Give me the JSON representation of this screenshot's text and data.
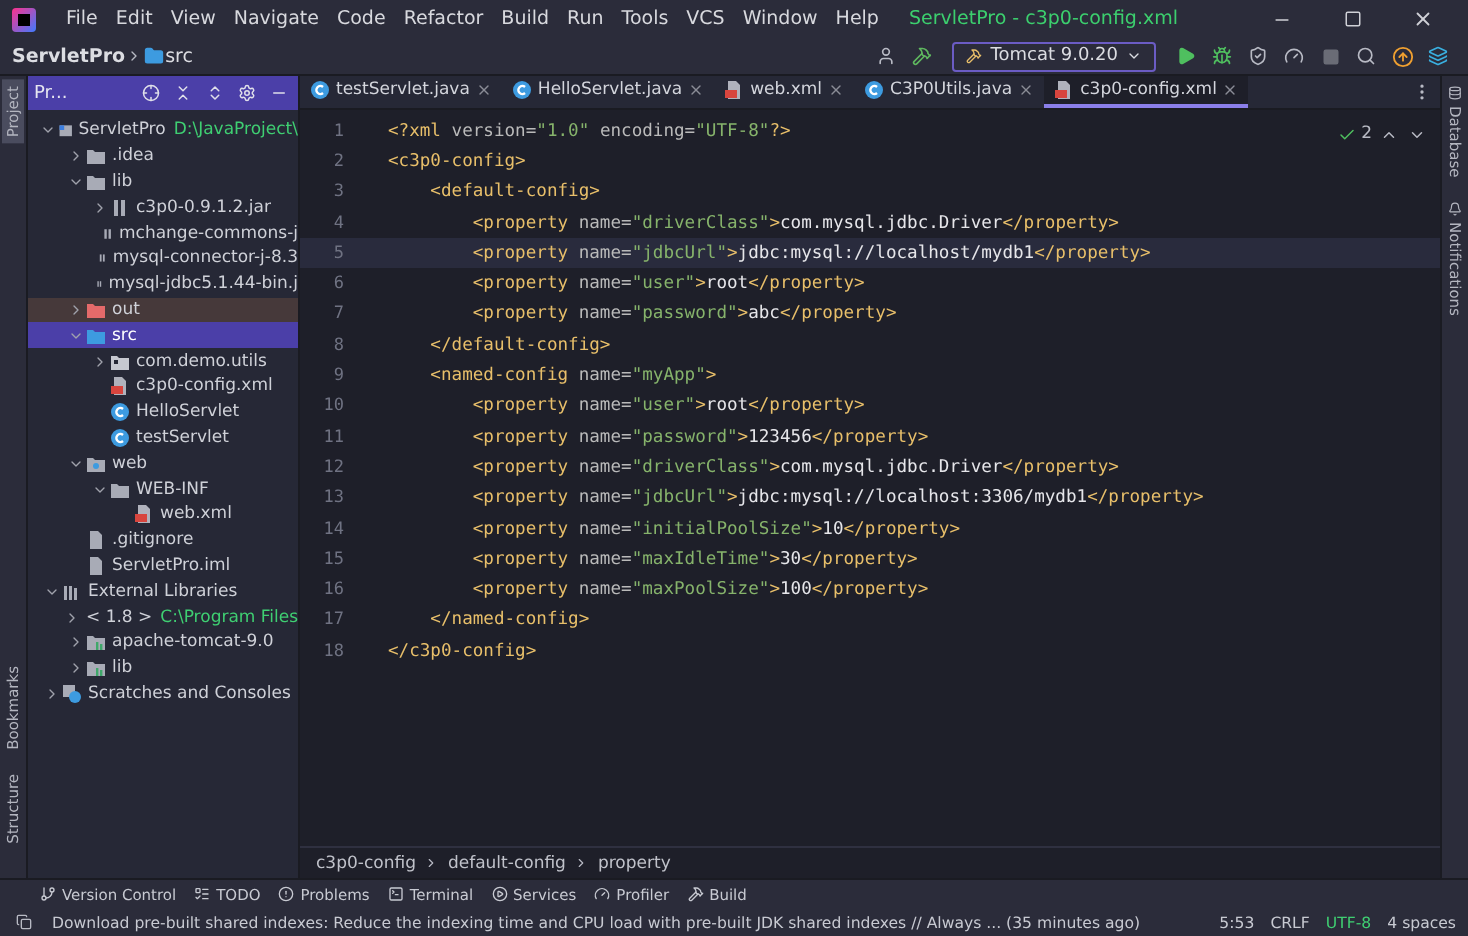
{
  "window": {
    "title": "ServletPro - c3p0-config.xml"
  },
  "menu": [
    "File",
    "Edit",
    "View",
    "Navigate",
    "Code",
    "Refactor",
    "Build",
    "Run",
    "Tools",
    "VCS",
    "Window",
    "Help"
  ],
  "navbar": {
    "breadcrumb": [
      "ServletPro",
      "src"
    ],
    "run_config": "Tomcat 9.0.20"
  },
  "left_strip": [
    {
      "label": "Project",
      "selected": true
    },
    {
      "label": "Bookmarks",
      "selected": false
    },
    {
      "label": "Structure",
      "selected": false
    }
  ],
  "right_strip": [
    "Database",
    "Notifications"
  ],
  "project_panel": {
    "title": "Pr...",
    "tree": [
      {
        "label": "ServletPro",
        "kind": "project",
        "note": "D:\\JavaProject\\",
        "expanded": true,
        "selected": false,
        "children": [
          {
            "label": ".idea",
            "kind": "folder",
            "expanded": false,
            "selected": false
          },
          {
            "label": "lib",
            "kind": "folder",
            "expanded": true,
            "selected": false,
            "children": [
              {
                "label": "c3p0-0.9.1.2.jar",
                "kind": "jar",
                "expanded": false,
                "selected": false
              },
              {
                "label": "mchange-commons-j",
                "kind": "jar",
                "selected": false
              },
              {
                "label": "mysql-connector-j-8.3",
                "kind": "jar",
                "selected": false
              },
              {
                "label": "mysql-jdbc5.1.44-bin.j",
                "kind": "jar",
                "selected": false
              }
            ]
          },
          {
            "label": "out",
            "kind": "excluded-folder",
            "expanded": false,
            "selected": false
          },
          {
            "label": "src",
            "kind": "source-folder",
            "expanded": true,
            "selected": true,
            "children": [
              {
                "label": "com.demo.utils",
                "kind": "package",
                "expanded": false,
                "selected": false
              },
              {
                "label": "c3p0-config.xml",
                "kind": "xml",
                "selected": false
              },
              {
                "label": "HelloServlet",
                "kind": "class",
                "selected": false
              },
              {
                "label": "testServlet",
                "kind": "class",
                "selected": false
              }
            ]
          },
          {
            "label": "web",
            "kind": "web-folder",
            "expanded": true,
            "selected": false,
            "children": [
              {
                "label": "WEB-INF",
                "kind": "folder",
                "expanded": true,
                "selected": false,
                "children": [
                  {
                    "label": "web.xml",
                    "kind": "xml",
                    "selected": false
                  }
                ]
              }
            ]
          },
          {
            "label": ".gitignore",
            "kind": "file",
            "selected": false
          },
          {
            "label": "ServletPro.iml",
            "kind": "file",
            "selected": false
          }
        ]
      },
      {
        "label": "External Libraries",
        "kind": "libraries",
        "expanded": true,
        "selected": false,
        "children": [
          {
            "label": "< 1.8 >",
            "kind": "sdk",
            "note": "C:\\Program Files",
            "expanded": false,
            "selected": false
          },
          {
            "label": "apache-tomcat-9.0",
            "kind": "library",
            "expanded": false,
            "selected": false
          },
          {
            "label": "lib",
            "kind": "library",
            "expanded": false,
            "selected": false
          }
        ]
      },
      {
        "label": "Scratches and Consoles",
        "kind": "scratch",
        "expanded": false,
        "selected": false
      }
    ]
  },
  "editor": {
    "tabs": [
      {
        "label": "testServlet.java",
        "kind": "class",
        "selected": false
      },
      {
        "label": "HelloServlet.java",
        "kind": "class",
        "selected": false
      },
      {
        "label": "web.xml",
        "kind": "xml",
        "selected": false
      },
      {
        "label": "C3P0Utils.java",
        "kind": "class",
        "selected": false
      },
      {
        "label": "c3p0-config.xml",
        "kind": "xml",
        "selected": true
      }
    ],
    "inspection_count": "2",
    "lines": [
      {
        "number": "1",
        "current": false,
        "tokens": [
          {
            "kind": "tag",
            "text": "<?xml "
          },
          {
            "kind": "attr",
            "text": "version="
          },
          {
            "kind": "value",
            "text": "\"1.0\" "
          },
          {
            "kind": "attr",
            "text": "encoding="
          },
          {
            "kind": "value",
            "text": "\"UTF-8\""
          },
          {
            "kind": "tag",
            "text": "?>"
          }
        ]
      },
      {
        "number": "2",
        "current": false,
        "tokens": [
          {
            "kind": "tag",
            "text": "<c3p0-config>"
          }
        ]
      },
      {
        "number": "3",
        "current": false,
        "tokens": [
          {
            "kind": "tag",
            "text": "    <default-config>"
          }
        ]
      },
      {
        "number": "4",
        "current": false,
        "tokens": [
          {
            "kind": "tag",
            "text": "        <property "
          },
          {
            "kind": "attr",
            "text": "name="
          },
          {
            "kind": "value",
            "text": "\"driverClass\""
          },
          {
            "kind": "tag",
            "text": ">"
          },
          {
            "kind": "text",
            "text": "com.mysql.jdbc.Driver"
          },
          {
            "kind": "tag",
            "text": "</property>"
          }
        ]
      },
      {
        "number": "5",
        "current": true,
        "tokens": [
          {
            "kind": "tag",
            "text": "        <property "
          },
          {
            "kind": "attr",
            "text": "name="
          },
          {
            "kind": "value",
            "text": "\"jdbcUrl\""
          },
          {
            "kind": "tag",
            "text": ">"
          },
          {
            "kind": "text",
            "text": "jdbc:mysql://localhost/mydb1"
          },
          {
            "kind": "tag",
            "text": "</property>"
          }
        ]
      },
      {
        "number": "6",
        "current": false,
        "tokens": [
          {
            "kind": "tag",
            "text": "        <property "
          },
          {
            "kind": "attr",
            "text": "name="
          },
          {
            "kind": "value",
            "text": "\"user\""
          },
          {
            "kind": "tag",
            "text": ">"
          },
          {
            "kind": "text",
            "text": "root"
          },
          {
            "kind": "tag",
            "text": "</property>"
          }
        ]
      },
      {
        "number": "7",
        "current": false,
        "tokens": [
          {
            "kind": "tag",
            "text": "        <property "
          },
          {
            "kind": "attr",
            "text": "name="
          },
          {
            "kind": "value",
            "text": "\"password\""
          },
          {
            "kind": "tag",
            "text": ">"
          },
          {
            "kind": "text",
            "text": "abc"
          },
          {
            "kind": "tag",
            "text": "</property>"
          }
        ]
      },
      {
        "number": "8",
        "current": false,
        "tokens": [
          {
            "kind": "tag",
            "text": "    </default-config>"
          }
        ]
      },
      {
        "number": "9",
        "current": false,
        "tokens": [
          {
            "kind": "tag",
            "text": "    <named-config "
          },
          {
            "kind": "attr",
            "text": "name="
          },
          {
            "kind": "value",
            "text": "\"myApp\""
          },
          {
            "kind": "tag",
            "text": ">"
          }
        ]
      },
      {
        "number": "10",
        "current": false,
        "tokens": [
          {
            "kind": "tag",
            "text": "        <property "
          },
          {
            "kind": "attr",
            "text": "name="
          },
          {
            "kind": "value",
            "text": "\"user\""
          },
          {
            "kind": "tag",
            "text": ">"
          },
          {
            "kind": "text",
            "text": "root"
          },
          {
            "kind": "tag",
            "text": "</property>"
          }
        ]
      },
      {
        "number": "11",
        "current": false,
        "tokens": [
          {
            "kind": "tag",
            "text": "        <property "
          },
          {
            "kind": "attr",
            "text": "name="
          },
          {
            "kind": "value",
            "text": "\"password\""
          },
          {
            "kind": "tag",
            "text": ">"
          },
          {
            "kind": "text",
            "text": "123456"
          },
          {
            "kind": "tag",
            "text": "</property>"
          }
        ]
      },
      {
        "number": "12",
        "current": false,
        "tokens": [
          {
            "kind": "tag",
            "text": "        <property "
          },
          {
            "kind": "attr",
            "text": "name="
          },
          {
            "kind": "value",
            "text": "\"driverClass\""
          },
          {
            "kind": "tag",
            "text": ">"
          },
          {
            "kind": "text",
            "text": "com.mysql.jdbc.Driver"
          },
          {
            "kind": "tag",
            "text": "</property>"
          }
        ]
      },
      {
        "number": "13",
        "current": false,
        "tokens": [
          {
            "kind": "tag",
            "text": "        <property "
          },
          {
            "kind": "attr",
            "text": "name="
          },
          {
            "kind": "value",
            "text": "\"jdbcUrl\""
          },
          {
            "kind": "tag",
            "text": ">"
          },
          {
            "kind": "text",
            "text": "jdbc:mysql://localhost:3306/mydb1"
          },
          {
            "kind": "tag",
            "text": "</property>"
          }
        ]
      },
      {
        "number": "14",
        "current": false,
        "tokens": [
          {
            "kind": "tag",
            "text": "        <property "
          },
          {
            "kind": "attr",
            "text": "name="
          },
          {
            "kind": "value",
            "text": "\"initialPoolSize\""
          },
          {
            "kind": "tag",
            "text": ">"
          },
          {
            "kind": "text",
            "text": "10"
          },
          {
            "kind": "tag",
            "text": "</property>"
          }
        ]
      },
      {
        "number": "15",
        "current": false,
        "tokens": [
          {
            "kind": "tag",
            "text": "        <property "
          },
          {
            "kind": "attr",
            "text": "name="
          },
          {
            "kind": "value",
            "text": "\"maxIdleTime\""
          },
          {
            "kind": "tag",
            "text": ">"
          },
          {
            "kind": "text",
            "text": "30"
          },
          {
            "kind": "tag",
            "text": "</property>"
          }
        ]
      },
      {
        "number": "16",
        "current": false,
        "tokens": [
          {
            "kind": "tag",
            "text": "        <property "
          },
          {
            "kind": "attr",
            "text": "name="
          },
          {
            "kind": "value",
            "text": "\"maxPoolSize\""
          },
          {
            "kind": "tag",
            "text": ">"
          },
          {
            "kind": "text",
            "text": "100"
          },
          {
            "kind": "tag",
            "text": "</property>"
          }
        ]
      },
      {
        "number": "17",
        "current": false,
        "tokens": [
          {
            "kind": "tag",
            "text": "    </named-config>"
          }
        ]
      },
      {
        "number": "18",
        "current": false,
        "tokens": [
          {
            "kind": "tag",
            "text": "</c3p0-config>"
          }
        ]
      }
    ],
    "breadcrumb": [
      "c3p0-config",
      "default-config",
      "property"
    ]
  },
  "tool_windows": [
    {
      "label": "Version Control",
      "kind": "vcs"
    },
    {
      "label": "TODO",
      "kind": "todo"
    },
    {
      "label": "Problems",
      "kind": "problems"
    },
    {
      "label": "Terminal",
      "kind": "terminal"
    },
    {
      "label": "Services",
      "kind": "services"
    },
    {
      "label": "Profiler",
      "kind": "profiler"
    },
    {
      "label": "Build",
      "kind": "build"
    }
  ],
  "status_bar": {
    "message": "Download pre-built shared indexes: Reduce the indexing time and CPU load with pre-built JDK shared indexes // Always ... (35 minutes ago)",
    "items": [
      "5:53",
      "CRLF",
      "UTF-8",
      "4 spaces"
    ]
  }
}
